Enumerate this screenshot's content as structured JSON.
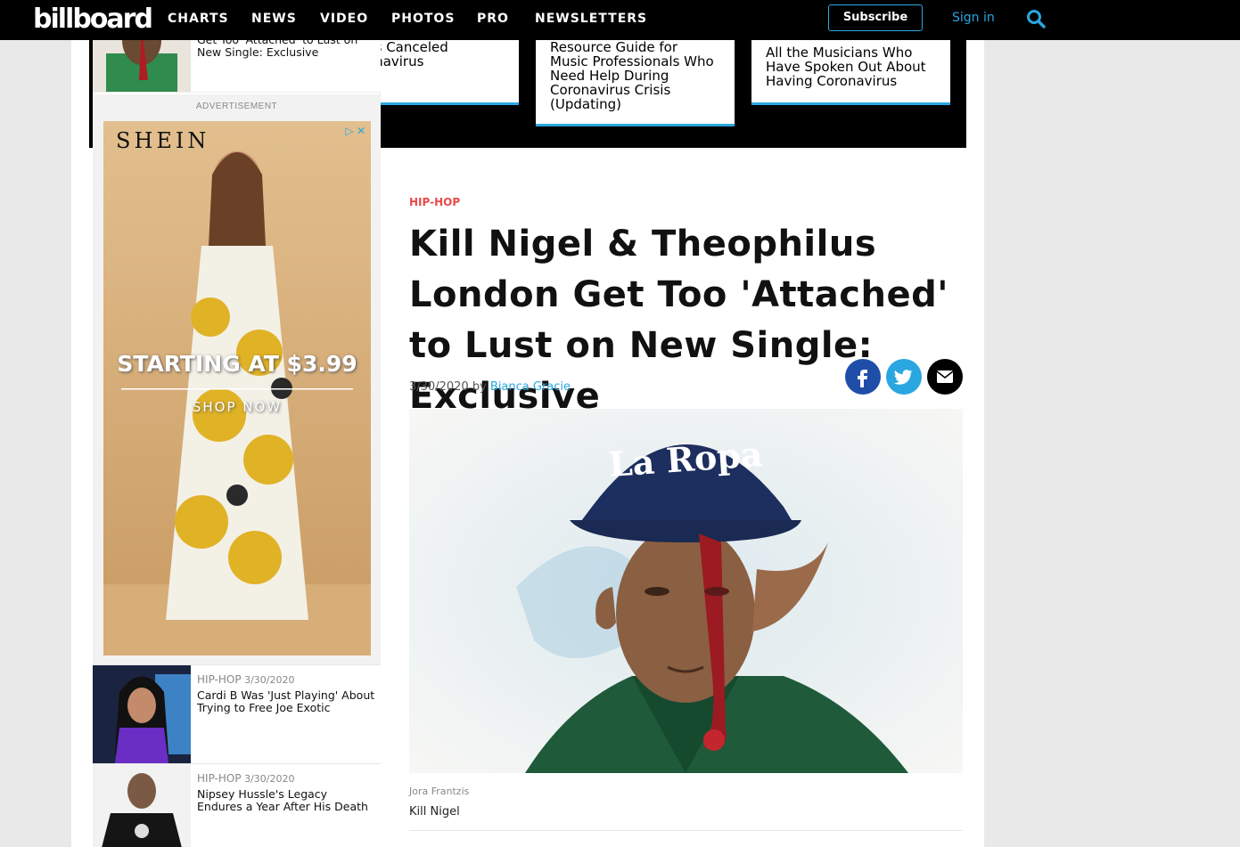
{
  "nav": {
    "logo": "billboard",
    "items": [
      "CHARTS",
      "NEWS",
      "VIDEO",
      "PHOTOS",
      "PRO",
      "NEWSLETTERS"
    ],
    "subscribe": "Subscribe",
    "sign_in": "Sign in",
    "search_icon": "search-icon",
    "accent": "#2aa6e0"
  },
  "trending": [
    {
      "text": "ents Canceled\noronavirus\ng)"
    },
    {
      "text": "Resource Guide for\nMusic Professionals Who\nNeed Help During\nCoronavirus Crisis\n(Updating)"
    },
    {
      "text": "All the Musicians Who\nHave Spoken Out About\nHaving Coronavirus"
    }
  ],
  "rail": {
    "top_item": {
      "title": "Get Too 'Attached' to Lust on New Single: Exclusive"
    },
    "ad": {
      "label": "ADVERTISEMENT",
      "brand": "SHEIN",
      "headline": "STARTING AT $3.99",
      "cta": "SHOP NOW"
    },
    "items": [
      {
        "category": "HIP-HOP",
        "date": "3/30/2020",
        "title": "Cardi B Was 'Just Playing' About Trying to Free Joe Exotic"
      },
      {
        "category": "HIP-HOP",
        "date": "3/30/2020",
        "title": "Nipsey Hussle's Legacy Endures a Year After His Death"
      }
    ]
  },
  "article": {
    "category": "HIP-HOP",
    "headline": "Kill Nigel & Theophilus London Get Too 'Attached' to Lust on New Single: Exclusive",
    "date": "3/30/2020",
    "by": "by",
    "author": "Bianca Gracie",
    "share": [
      {
        "icon": "facebook-icon",
        "color": "#1f4ea8"
      },
      {
        "icon": "twitter-icon",
        "color": "#2aa6e0"
      },
      {
        "icon": "email-icon",
        "color": "#000000"
      }
    ],
    "photo_credit": "Jora Frantzis",
    "caption": "Kill Nigel",
    "hat_text": "La Ropa"
  }
}
